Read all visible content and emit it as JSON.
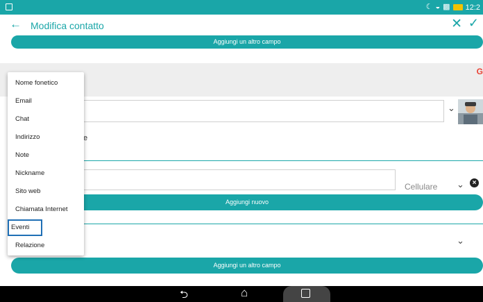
{
  "status_bar": {
    "time": "12:2",
    "icons": [
      "moon-icon",
      "wifi-icon",
      "signal-icon",
      "battery-icon"
    ]
  },
  "app_bar": {
    "title": "Modifica contatto"
  },
  "buttons": {
    "add_field_top": "Aggiungi un altro campo",
    "add_new": "Aggiungi nuovo",
    "add_field_bottom": "Aggiungi un altro campo"
  },
  "phone_section": {
    "type_label": "Cellulare"
  },
  "partial_text": "e",
  "menu": {
    "items": [
      "Nome fonetico",
      "Email",
      "Chat",
      "Indirizzo",
      "Note",
      "Nickname",
      "Sito web",
      "Chiamata Internet",
      "Eventi",
      "Relazione"
    ],
    "selected": "Eventi"
  },
  "colors": {
    "accent": "#1aa6a8",
    "selection_outline": "#1f6fb5"
  }
}
